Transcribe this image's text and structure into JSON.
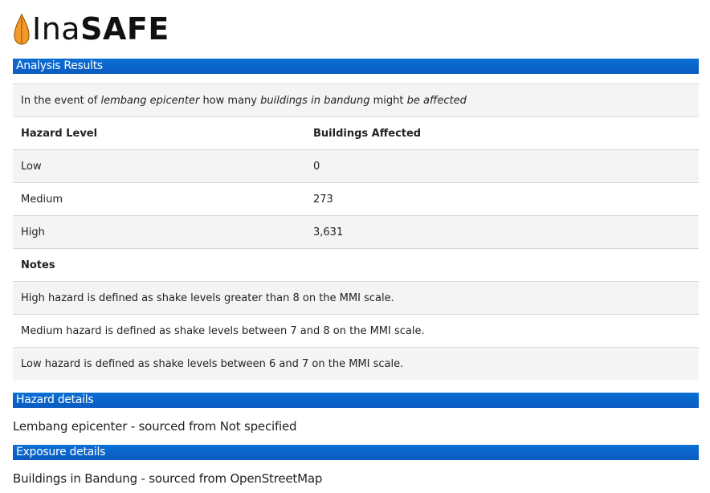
{
  "brand": {
    "name_light": "Ina",
    "name_bold": "SAFE",
    "icon": "teardrop-flame-icon",
    "colors": {
      "icon_fill": "#f39a2b",
      "icon_stroke": "#a35a00",
      "bar": "#0b64cc"
    }
  },
  "analysis": {
    "heading": "Analysis Results",
    "question": {
      "p1": "In the event of ",
      "hazard": "lembang epicenter",
      "p2": " how many ",
      "exposure": "buildings in bandung",
      "p3": " might ",
      "impact": "be affected"
    },
    "table": {
      "col_hazard": "Hazard Level",
      "col_buildings": "Buildings Affected",
      "rows": [
        {
          "level": "Low",
          "count": "0"
        },
        {
          "level": "Medium",
          "count": "273"
        },
        {
          "level": "High",
          "count": "3,631"
        }
      ]
    },
    "notes_heading": "Notes",
    "notes": [
      "High hazard is defined as shake levels greater than 8 on the MMI scale.",
      "Medium hazard is defined as shake levels between 7 and 8 on the MMI scale.",
      "Low hazard is defined as shake levels between 6 and 7 on the MMI scale."
    ]
  },
  "hazard_details": {
    "heading": "Hazard details",
    "text": "Lembang epicenter - sourced from Not specified"
  },
  "exposure_details": {
    "heading": "Exposure details",
    "text": "Buildings in Bandung - sourced from OpenStreetMap"
  }
}
